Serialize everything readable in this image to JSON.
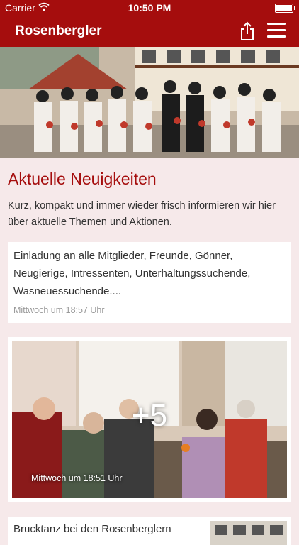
{
  "status_bar": {
    "carrier": "Carrier",
    "time": "10:50 PM"
  },
  "nav": {
    "title": "Rosenbergler",
    "share_icon": "share-icon",
    "menu_icon": "hamburger-menu-icon"
  },
  "colors": {
    "brand": "#a50d0d",
    "background": "#f6e9ea"
  },
  "hero": {
    "description": "group-photo-in-traditional-costume"
  },
  "section": {
    "title": "Aktuelle Neuigkeiten",
    "description": "Kurz, kompakt und immer wieder frisch informieren wir hier über aktuelle Themen und Aktionen."
  },
  "posts": [
    {
      "text": "Einladung an alle Mitglieder, Freunde, Gönner, Neugierige, Intressenten, Unterhaltungssuchende, Wasneuessuchende....",
      "time": "Mittwoch um 18:57 Uhr"
    },
    {
      "more": "+5",
      "time": "Mittwoch um 18:51 Uhr"
    },
    {
      "text": "Brucktanz bei den Rosenberglern"
    }
  ]
}
